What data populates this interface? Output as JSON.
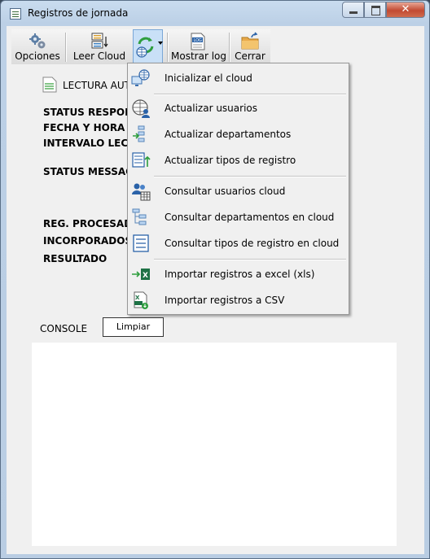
{
  "window": {
    "title": "Registros de jornada"
  },
  "toolbar": {
    "opciones": "Opciones",
    "leer_cloud": "Leer Cloud",
    "mostrar_log": "Mostrar log",
    "cerrar": "Cerrar"
  },
  "form": {
    "lectura": "LECTURA AUTO",
    "status_response": "STATUS RESPON",
    "fecha_hora": "FECHA Y HORA IN",
    "intervalo": "INTERVALO LECT",
    "status_message": "STATUS MESSAG",
    "reg_procesados": "REG. PROCESADO",
    "incorporados": "INCORPORADOS",
    "resultado": "RESULTADO",
    "console_label": "CONSOLE",
    "limpiar": "Limpiar"
  },
  "menu": {
    "items": [
      {
        "label": "Inicializar el cloud",
        "icon": "cloud-init-icon"
      },
      {
        "label": "Actualizar usuarios",
        "icon": "update-users-icon"
      },
      {
        "label": "Actualizar departamentos",
        "icon": "update-departments-icon"
      },
      {
        "label": "Actualizar tipos de registro",
        "icon": "update-record-types-icon"
      },
      {
        "label": "Consultar usuarios cloud",
        "icon": "query-users-icon"
      },
      {
        "label": "Consultar departamentos en cloud",
        "icon": "query-departments-icon"
      },
      {
        "label": "Consultar tipos de registro en cloud",
        "icon": "query-record-types-icon"
      },
      {
        "label": "Importar registros a excel (xls)",
        "icon": "excel-import-icon"
      },
      {
        "label": "Importar registros a CSV",
        "icon": "csv-import-icon"
      }
    ]
  }
}
